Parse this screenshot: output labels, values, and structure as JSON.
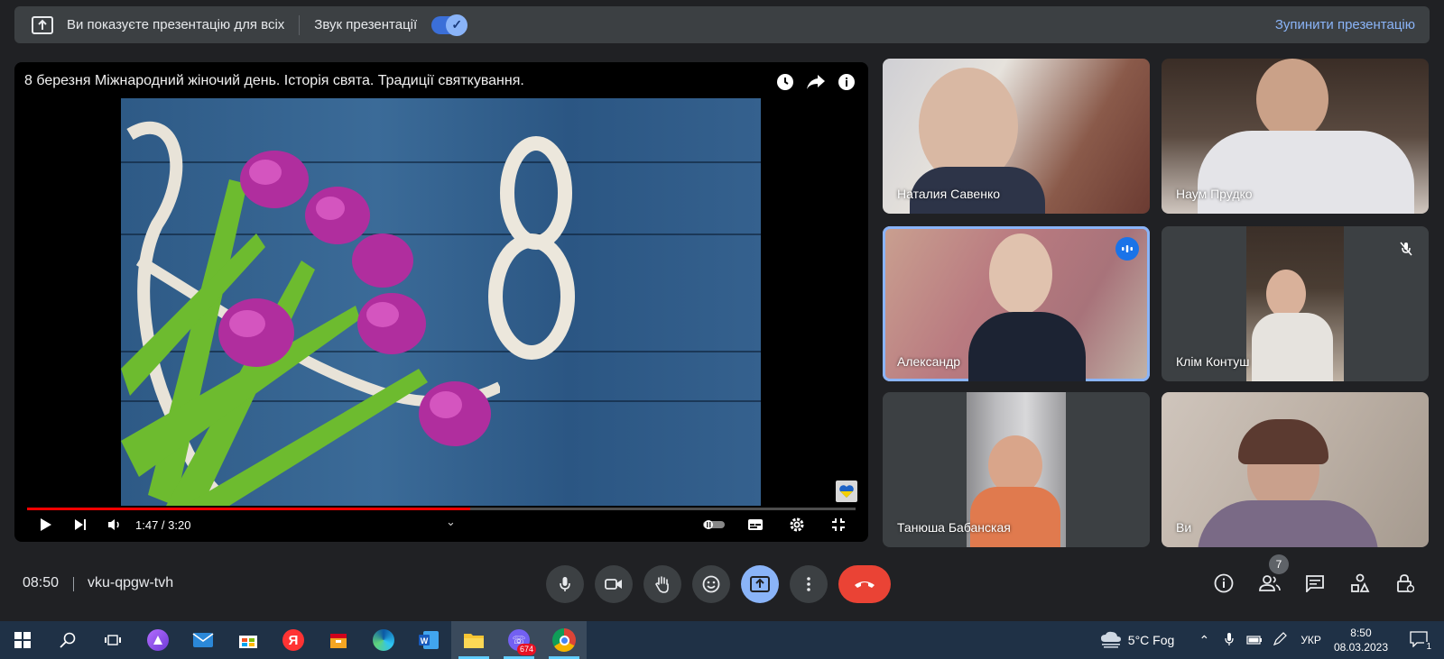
{
  "present_bar": {
    "message": "Ви показуєте презентацію для всіх",
    "sound_label": "Звук презентації",
    "stop_label": "Зупинити презентацію",
    "sound_enabled": true
  },
  "player": {
    "title": "8 березня Міжнародний жіночий день. Історія свята. Традиції святкування.",
    "time": "1:47 / 3:20",
    "progress_fraction": 0.535,
    "icons": [
      "clock-icon",
      "share-icon",
      "info-icon"
    ]
  },
  "participants": [
    {
      "name": "Наталия Савенко"
    },
    {
      "name": "Наум Прудко"
    },
    {
      "name": "Александр",
      "speaking": true
    },
    {
      "name": "Клім Контуш",
      "muted": true
    },
    {
      "name": "Танюша Бабанская"
    },
    {
      "name": "Ви"
    }
  ],
  "bottom_bar": {
    "clock": "08:50",
    "meeting_code": "vku-qpgw-tvh",
    "people_count": "7"
  },
  "taskbar": {
    "weather": "5°C  Fog",
    "language": "УКР",
    "time": "8:50",
    "date": "08.03.2023",
    "viber_badge": "674",
    "notifications": "1"
  },
  "colors": {
    "accent": "#8ab4f8",
    "end_call": "#ea4335",
    "progress": "#ff0000"
  }
}
